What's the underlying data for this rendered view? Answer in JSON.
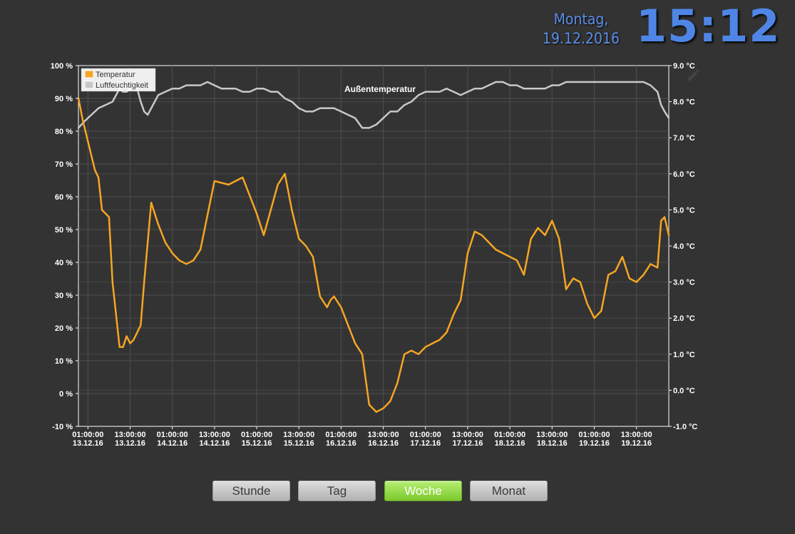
{
  "header": {
    "day_line": "Montag,",
    "date_line": "19.12.2016",
    "time": "15:12"
  },
  "chart_data": {
    "type": "line",
    "title": "Außentemperatur",
    "legend_position": "top-left",
    "grid": true,
    "left_axis": {
      "unit": "%",
      "ylim": [
        -10,
        100
      ],
      "tick_labels": [
        "100 %",
        "90 %",
        "80 %",
        "70 %",
        "60 %",
        "50 %",
        "40 %",
        "30 %",
        "20 %",
        "10 %",
        "0 %",
        "-10 %"
      ]
    },
    "right_axis": {
      "unit": "°C",
      "ylim": [
        -1.0,
        9.0
      ],
      "tick_labels": [
        "9.0 °C",
        "8.0 °C",
        "7.0 °C",
        "6.0 °C",
        "5.0 °C",
        "4.0 °C",
        "3.0 °C",
        "2.0 °C",
        "1.0 °C",
        "0.0 °C",
        "-1.0 °C"
      ]
    },
    "x_tick_labels": [
      [
        "01:00:00",
        "13.12.16"
      ],
      [
        "13:00:00",
        "13.12.16"
      ],
      [
        "01:00:00",
        "14.12.16"
      ],
      [
        "13:00:00",
        "14.12.16"
      ],
      [
        "01:00:00",
        "15.12.16"
      ],
      [
        "13:00:00",
        "15.12.16"
      ],
      [
        "01:00:00",
        "16.12.16"
      ],
      [
        "13:00:00",
        "16.12.16"
      ],
      [
        "01:00:00",
        "17.12.16"
      ],
      [
        "13:00:00",
        "17.12.16"
      ],
      [
        "01:00:00",
        "18.12.16"
      ],
      [
        "13:00:00",
        "18.12.16"
      ],
      [
        "01:00:00",
        "19.12.16"
      ],
      [
        "13:00:00",
        "19.12.16"
      ]
    ],
    "x_unit": "hours",
    "x_range": [
      -2.7,
      165.2
    ],
    "series": [
      {
        "name": "Temperatur",
        "axis": "right",
        "color": "#f5a623",
        "x": [
          -2.7,
          -1.5,
          0,
          1,
          2,
          3,
          4,
          5,
          6,
          7,
          9,
          10,
          11,
          12,
          13,
          15,
          16,
          18,
          20,
          22,
          24,
          26,
          28,
          30,
          32,
          36,
          40,
          42,
          44,
          46,
          48,
          50,
          52,
          54,
          56,
          58,
          60,
          62,
          64,
          66,
          68,
          69,
          70,
          72,
          74,
          76,
          78,
          80,
          82,
          84,
          86,
          88,
          90,
          92,
          94,
          96,
          98,
          100,
          102,
          104,
          106,
          108,
          110,
          112,
          114,
          116,
          118,
          120,
          122,
          124,
          126,
          128,
          130,
          132,
          134,
          136,
          138,
          140,
          142,
          144,
          146,
          148,
          150,
          152,
          154,
          156,
          158,
          160,
          162,
          163,
          164,
          165.2
        ],
        "y": [
          8.1,
          7.5,
          6.9,
          6.5,
          6.1,
          5.9,
          5.0,
          4.9,
          4.8,
          3.0,
          1.2,
          1.2,
          1.5,
          1.3,
          1.4,
          1.8,
          3.0,
          5.2,
          4.6,
          4.1,
          3.8,
          3.6,
          3.5,
          3.6,
          3.9,
          5.8,
          5.7,
          5.8,
          5.9,
          5.4,
          4.9,
          4.3,
          5.0,
          5.7,
          6.0,
          5.0,
          4.2,
          4.0,
          3.7,
          2.6,
          2.3,
          2.5,
          2.6,
          2.3,
          1.8,
          1.3,
          1.0,
          -0.4,
          -0.6,
          -0.5,
          -0.3,
          0.2,
          1.0,
          1.1,
          1.0,
          1.2,
          1.3,
          1.4,
          1.6,
          2.1,
          2.5,
          3.8,
          4.4,
          4.3,
          4.1,
          3.9,
          3.8,
          3.7,
          3.6,
          3.2,
          4.2,
          4.5,
          4.3,
          4.7,
          4.2,
          2.8,
          3.1,
          3.0,
          2.4,
          2.0,
          2.2,
          3.2,
          3.3,
          3.7,
          3.1,
          3.0,
          3.2,
          3.5,
          3.4,
          4.7,
          4.8,
          4.3
        ]
      },
      {
        "name": "Luftfeuchtigkeit",
        "axis": "left",
        "color": "#c8c8c8",
        "x": [
          -2.7,
          -1,
          1,
          3,
          5,
          7,
          8,
          9,
          10,
          11,
          12,
          13,
          14,
          15,
          16,
          17,
          18,
          20,
          22,
          24,
          26,
          28,
          30,
          32,
          34,
          36,
          38,
          40,
          42,
          44,
          46,
          48,
          50,
          52,
          54,
          56,
          58,
          60,
          62,
          64,
          66,
          68,
          70,
          72,
          74,
          76,
          78,
          80,
          82,
          84,
          86,
          88,
          90,
          92,
          94,
          96,
          98,
          100,
          102,
          104,
          106,
          108,
          110,
          112,
          114,
          116,
          118,
          120,
          122,
          124,
          126,
          128,
          130,
          132,
          134,
          136,
          138,
          140,
          142,
          144,
          146,
          148,
          150,
          152,
          154,
          156,
          158,
          160,
          162,
          163,
          164,
          165.2
        ],
        "y": [
          81,
          83,
          85,
          87,
          88,
          89,
          91,
          93,
          92,
          92,
          93,
          94,
          93,
          89,
          86,
          85,
          87,
          91,
          92,
          93,
          93,
          94,
          94,
          94,
          95,
          94,
          93,
          93,
          93,
          92,
          92,
          93,
          93,
          92,
          92,
          90,
          89,
          87,
          86,
          86,
          87,
          87,
          87,
          86,
          85,
          84,
          81,
          81,
          82,
          84,
          86,
          86,
          88,
          89,
          91,
          92,
          92,
          92,
          93,
          92,
          91,
          92,
          93,
          93,
          94,
          95,
          95,
          94,
          94,
          93,
          93,
          93,
          93,
          94,
          94,
          95,
          95,
          95,
          95,
          95,
          95,
          95,
          95,
          95,
          95,
          95,
          95,
          94,
          92,
          88,
          86,
          84
        ]
      }
    ]
  },
  "buttons": {
    "stunde": "Stunde",
    "tag": "Tag",
    "woche": "Woche",
    "monat": "Monat"
  }
}
